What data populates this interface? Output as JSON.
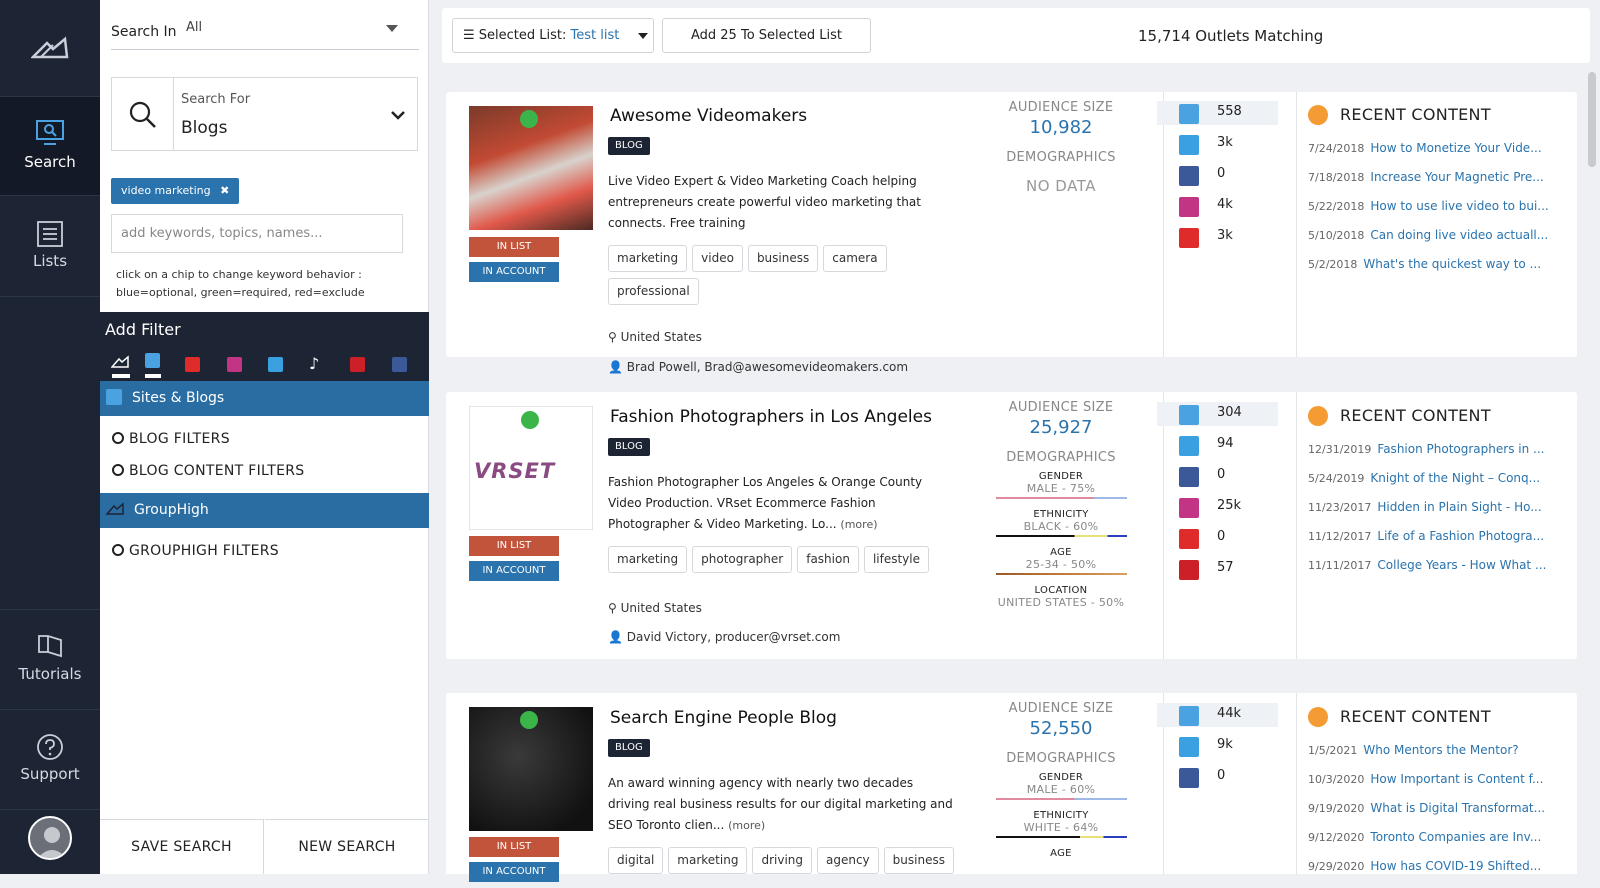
{
  "nav": {
    "items": [
      {
        "label": "Search"
      },
      {
        "label": "Lists"
      },
      {
        "label": "Tutorials"
      },
      {
        "label": "Support"
      }
    ]
  },
  "sidebar": {
    "search_in_label": "Search In",
    "search_in_value": "All",
    "search_for_label": "Search For",
    "search_for_value": "Blogs",
    "chip": "video marketing",
    "keyword_placeholder": "add keywords, topics, names...",
    "help_line1": "click on a chip to change keyword behavior :",
    "help_line2": "blue=optional, green=required, red=exclude",
    "add_filter": "Add Filter",
    "sites_blogs": "Sites & Blogs",
    "blog_filters": "BLOG FILTERS",
    "blog_content_filters": "BLOG CONTENT FILTERS",
    "grouphigh": "GroupHigh",
    "grouphigh_filters": "GROUPHIGH FILTERS",
    "save_search": "SAVE SEARCH",
    "new_search": "NEW SEARCH"
  },
  "toolbar": {
    "selected_list_label": "Selected List:",
    "selected_list_value": "Test list",
    "add_button": "Add 25 To Selected List",
    "matching": "15,714 Outlets Matching"
  },
  "common": {
    "in_list": "IN LIST",
    "in_account": "IN ACCOUNT",
    "blog_badge": "BLOG",
    "audience_size": "AUDIENCE SIZE",
    "demographics": "DEMOGRAPHICS",
    "recent_content": "RECENT CONTENT",
    "more": "(more)",
    "gender": "GENDER",
    "ethnicity": "ETHNICITY",
    "age": "AGE",
    "location": "LOCATION"
  },
  "results": [
    {
      "title": "Awesome Videomakers",
      "desc": "Live Video Expert & Video Marketing Coach helping entrepreneurs create powerful video marketing that connects. Free training",
      "tags": [
        "marketing",
        "video",
        "business",
        "camera",
        "professional"
      ],
      "location": "United States",
      "contact": "Brad Powell, Brad@awesomevideomakers.com",
      "audience": "10,982",
      "no_data": "NO DATA",
      "social": [
        "558",
        "3k",
        "0",
        "4k",
        "3k"
      ],
      "recent": [
        {
          "date": "7/24/2018",
          "title": "How to Monetize Your Vide..."
        },
        {
          "date": "7/18/2018",
          "title": "Increase Your Magnetic Pre..."
        },
        {
          "date": "5/22/2018",
          "title": "How to use live video to bui..."
        },
        {
          "date": "5/10/2018",
          "title": "Can doing live video actuall..."
        },
        {
          "date": "5/2/2018",
          "title": "What's the quickest way to ..."
        }
      ]
    },
    {
      "title": "Fashion Photographers in Los Angeles",
      "desc": "Fashion Photographer Los Angeles & Orange County Video Production. VRset Ecommerce Fashion Photographer & Video Marketing. Lo...",
      "logo_text": "VRSET",
      "tags": [
        "marketing",
        "photographer",
        "fashion",
        "lifestyle"
      ],
      "location": "United States",
      "contact": "David Victory, producer@vrset.com",
      "audience": "25,927",
      "gender": "MALE - 75%",
      "ethnicity": "BLACK - 60%",
      "age": "25-34 - 50%",
      "location_demo": "UNITED STATES - 50%",
      "social": [
        "304",
        "94",
        "0",
        "25k",
        "0",
        "57"
      ],
      "recent": [
        {
          "date": "12/31/2019",
          "title": "Fashion Photographers in ..."
        },
        {
          "date": "5/24/2019",
          "title": "Knight of the Night – Conq..."
        },
        {
          "date": "11/23/2017",
          "title": "Hidden in Plain Sight - Ho..."
        },
        {
          "date": "11/12/2017",
          "title": "Life of a Fashion Photogra..."
        },
        {
          "date": "11/11/2017",
          "title": "College Years - How What ..."
        }
      ]
    },
    {
      "title": "Search Engine People Blog",
      "desc": "An award winning agency with nearly two decades driving real business results for our digital marketing and SEO Toronto clien...",
      "tags": [
        "digital",
        "marketing",
        "driving",
        "agency",
        "business"
      ],
      "audience": "52,550",
      "gender": "MALE - 60%",
      "ethnicity": "WHITE - 64%",
      "age": "AGE",
      "social": [
        "44k",
        "9k",
        "0"
      ],
      "recent": [
        {
          "date": "1/5/2021",
          "title": "Who Mentors the Mentor?"
        },
        {
          "date": "10/3/2020",
          "title": "How Important is Content f..."
        },
        {
          "date": "9/19/2020",
          "title": "What is Digital Transformat..."
        },
        {
          "date": "9/12/2020",
          "title": "Toronto Companies are Inv..."
        },
        {
          "date": "9/29/2020",
          "title": "How has COVID-19 Shifted..."
        }
      ]
    }
  ],
  "colors": {
    "nav_bg": "#1d2433",
    "accent_blue": "#2a73ad",
    "in_list": "#c2543b",
    "check_green": "#3bb54a",
    "rss_orange": "#f49b33"
  }
}
